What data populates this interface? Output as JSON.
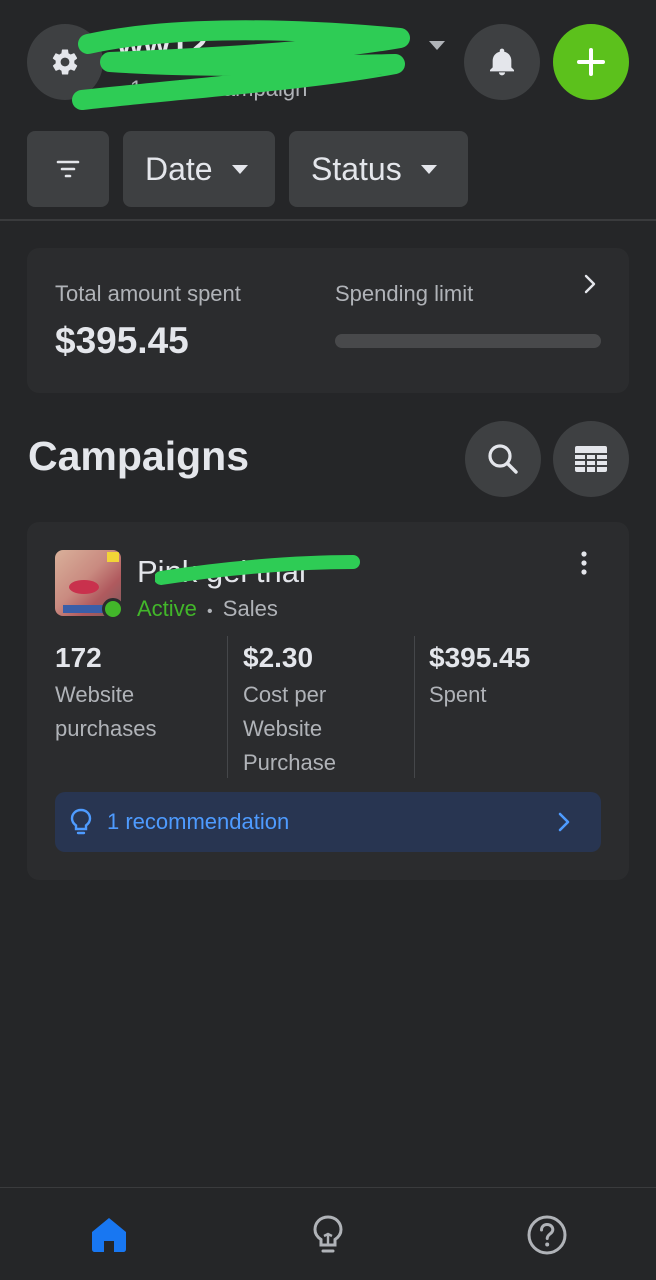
{
  "header": {
    "account_name": "ww12",
    "account_sub": "1 active campaign",
    "icons": {
      "settings": "gear-icon",
      "account_caret": "caret-down-icon",
      "notifications": "bell-icon",
      "create": "plus-icon"
    }
  },
  "filters": {
    "items": [
      {
        "label": "",
        "icon": "filter-icon"
      },
      {
        "label": "Date",
        "icon": "caret-down-icon"
      },
      {
        "label": "Status",
        "icon": "caret-down-icon"
      }
    ]
  },
  "spend_summary": {
    "total_label": "Total amount spent",
    "total_value": "$395.45",
    "limit_label": "Spending limit",
    "limit_progress": 0
  },
  "campaigns": {
    "title": "Campaigns",
    "icons": {
      "search": "search-icon",
      "table": "table-icon"
    },
    "items": [
      {
        "name": "Pink gel trial",
        "status": "Active",
        "separator": "•",
        "objective": "Sales",
        "metrics": [
          {
            "value": "172",
            "label": "Website purchases"
          },
          {
            "value": "$2.30",
            "label": "Cost per Website Purchase"
          },
          {
            "value": "$395.45",
            "label": "Spent"
          }
        ],
        "recommendation": "1 recommendation"
      }
    ]
  },
  "bottom_nav": {
    "items": [
      {
        "name": "home",
        "icon": "home-icon",
        "active": true
      },
      {
        "name": "insights",
        "icon": "lightbulb-icon",
        "active": false
      },
      {
        "name": "help",
        "icon": "help-icon",
        "active": false
      }
    ]
  },
  "colors": {
    "background": "#252628",
    "card": "#2b2c2e",
    "button": "#3e4042",
    "accent_green": "#5cc11c",
    "status_green": "#42b72a",
    "link_blue": "#4e9bff",
    "active_nav": "#1877f2",
    "redaction": "#2ecc55"
  }
}
